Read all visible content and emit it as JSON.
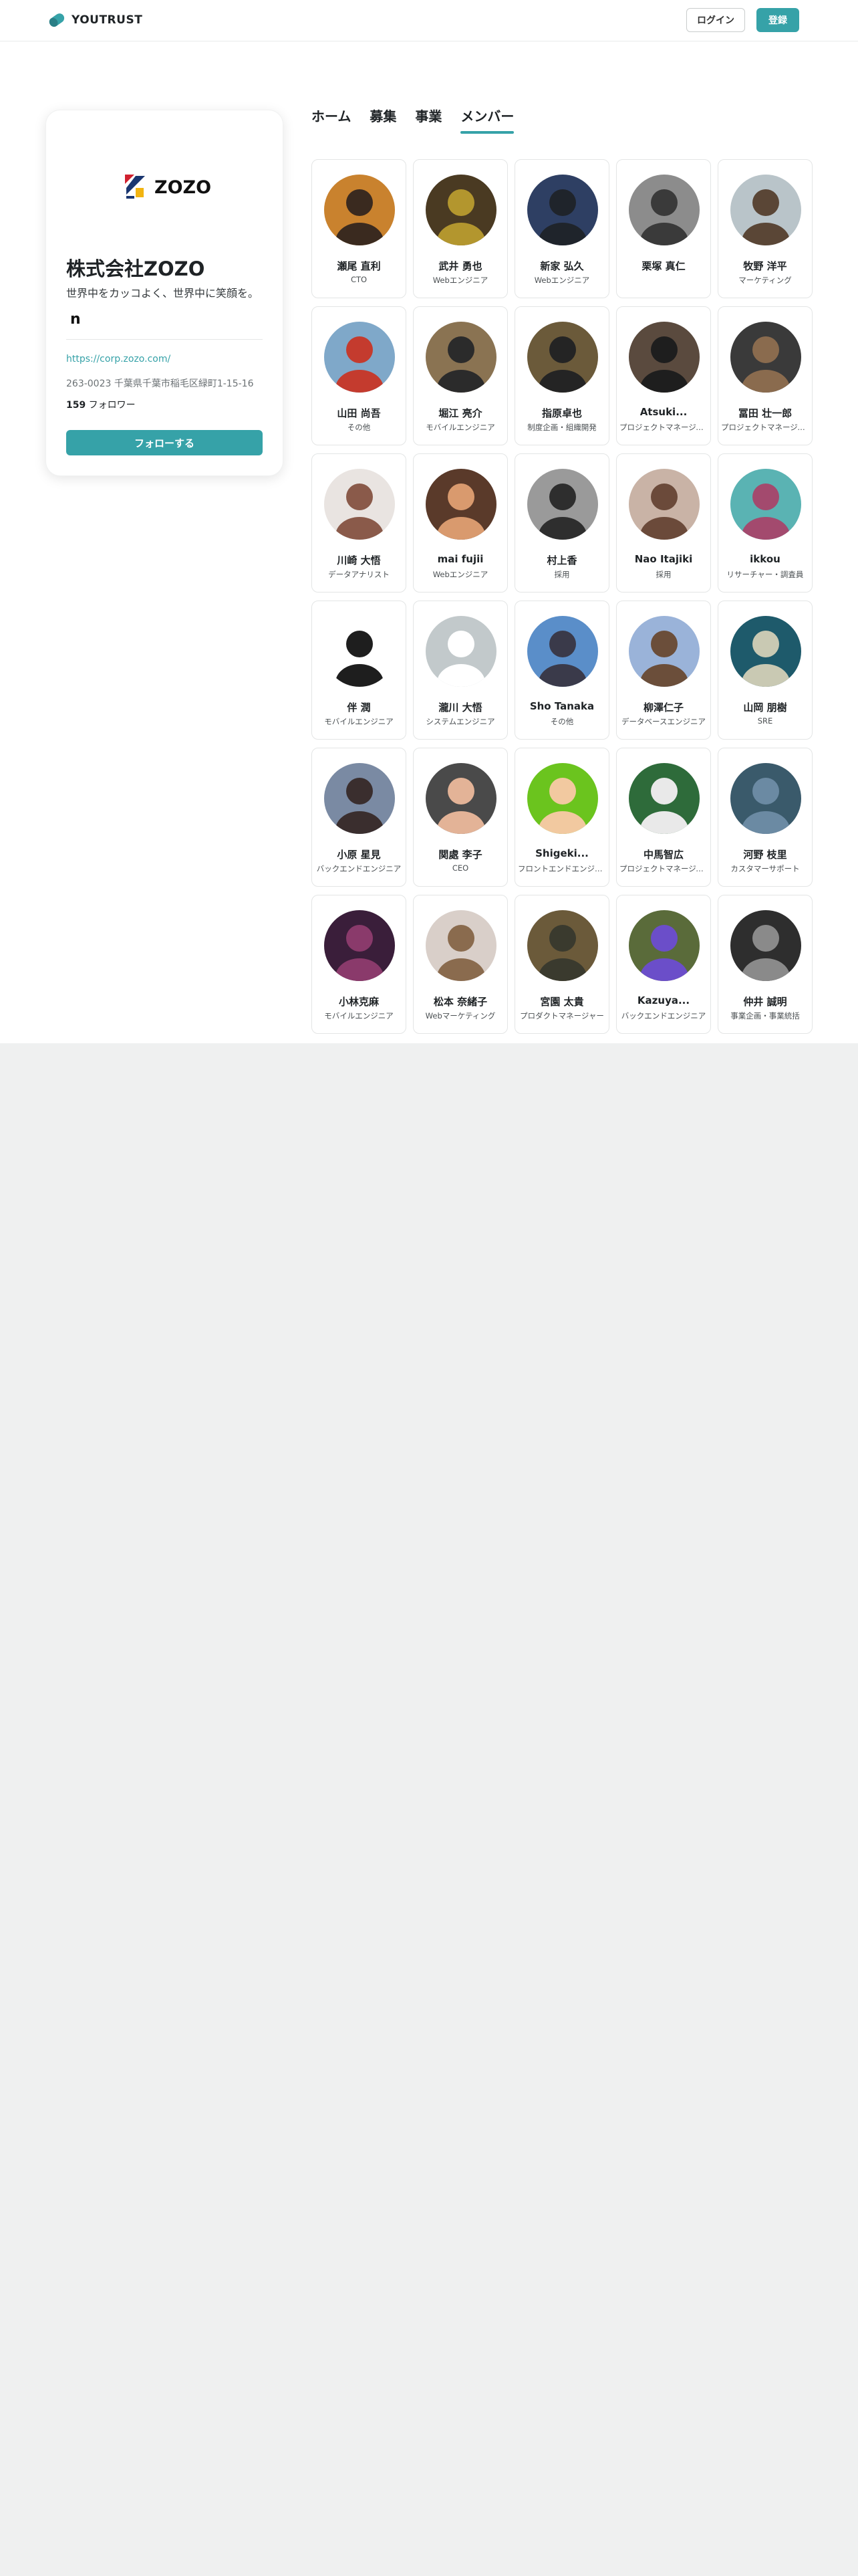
{
  "header": {
    "logo_text": "YOUTRUST",
    "logo_icon": "youtrust-logo-icon",
    "login_label": "ログイン",
    "register_label": "登録"
  },
  "company": {
    "logo_text": "ZOZO",
    "name": "株式会社ZOZO",
    "tagline": "世界中をカッコよく、世界中に笑顔を。",
    "note_icon_glyph": "n",
    "url": "https://corp.zozo.com/",
    "address": "263-0023 千葉県千葉市稲毛区緑町1-15-16",
    "follower_count": "159",
    "follower_label": " フォロワー",
    "follow_button_label": "フォローする"
  },
  "tabs": [
    {
      "label": "ホーム",
      "active": false
    },
    {
      "label": "募集",
      "active": false
    },
    {
      "label": "事業",
      "active": false
    },
    {
      "label": "メンバー",
      "active": true
    }
  ],
  "members": [
    {
      "name": "瀬尾 直利",
      "role": "CTO",
      "avatar": {
        "bg": "#c9822e",
        "fg": "#3a2a1f"
      }
    },
    {
      "name": "武井 勇也",
      "role": "Webエンジニア",
      "avatar": {
        "bg": "#4a3a22",
        "fg": "#b3962e"
      }
    },
    {
      "name": "新家 弘久",
      "role": "Webエンジニア",
      "avatar": {
        "bg": "#2e3f63",
        "fg": "#1f242b"
      }
    },
    {
      "name": "栗塚 真仁",
      "role": "",
      "avatar": {
        "bg": "#8c8c8c",
        "fg": "#3a3a3a"
      }
    },
    {
      "name": "牧野 洋平",
      "role": "マーケティング",
      "avatar": {
        "bg": "#b9c4c9",
        "fg": "#5a4636"
      }
    },
    {
      "name": "山田 尚吾",
      "role": "その他",
      "avatar": {
        "bg": "#7fa8c9",
        "fg": "#c43b2e"
      }
    },
    {
      "name": "堀江 亮介",
      "role": "モバイルエンジニア",
      "avatar": {
        "bg": "#8a7352",
        "fg": "#2b2b2b"
      }
    },
    {
      "name": "指原卓也",
      "role": "制度企画・組織開発",
      "avatar": {
        "bg": "#6b5a3a",
        "fg": "#242424"
      }
    },
    {
      "name": "Atsuki...",
      "role": "プロジェクトマネージャー",
      "avatar": {
        "bg": "#5a4a3e",
        "fg": "#1e1e1e"
      }
    },
    {
      "name": "冨田 壮一郎",
      "role": "プロジェクトマネージャー",
      "avatar": {
        "bg": "#3a3a3a",
        "fg": "#8a6b4e"
      }
    },
    {
      "name": "川崎 大悟",
      "role": "データアナリスト",
      "avatar": {
        "bg": "#e9e4e1",
        "fg": "#8a5a4a"
      }
    },
    {
      "name": "mai fujii",
      "role": "Webエンジニア",
      "avatar": {
        "bg": "#5a3a2a",
        "fg": "#d99a6e"
      }
    },
    {
      "name": "村上香",
      "role": "採用",
      "avatar": {
        "bg": "#9a9a9a",
        "fg": "#2e2e2e"
      }
    },
    {
      "name": "Nao Itajiki",
      "role": "採用",
      "avatar": {
        "bg": "#c9b3a6",
        "fg": "#6b4a3a"
      }
    },
    {
      "name": "ikkou",
      "role": "リサーチャー・調査員",
      "avatar": {
        "bg": "#5ab3b3",
        "fg": "#a34a6e"
      }
    },
    {
      "name": "伴 潤",
      "role": "モバイルエンジニア",
      "avatar": {
        "bg": "#ffffff",
        "fg": "#1e1e1e"
      }
    },
    {
      "name": "瀧川 大悟",
      "role": "システムエンジニア",
      "avatar": {
        "bg": "#c2c9cb",
        "fg": "#ffffff"
      }
    },
    {
      "name": "Sho Tanaka",
      "role": "その他",
      "avatar": {
        "bg": "#5a8ec9",
        "fg": "#3a3a4a"
      }
    },
    {
      "name": "柳澤仁子",
      "role": "データベースエンジニア",
      "avatar": {
        "bg": "#9ab3d9",
        "fg": "#6b4e3a"
      }
    },
    {
      "name": "山岡 朋樹",
      "role": "SRE",
      "avatar": {
        "bg": "#1e5a6b",
        "fg": "#c9c9b3"
      }
    },
    {
      "name": "小原 星見",
      "role": "バックエンドエンジニア",
      "avatar": {
        "bg": "#7a8aa3",
        "fg": "#3a2e2e"
      }
    },
    {
      "name": "関處 李子",
      "role": "CEO",
      "avatar": {
        "bg": "#4a4a4a",
        "fg": "#e3b397"
      }
    },
    {
      "name": "Shigeki...",
      "role": "フロントエンドエンジニア",
      "avatar": {
        "bg": "#6bc41e",
        "fg": "#f2c9a0"
      }
    },
    {
      "name": "中馬智広",
      "role": "プロジェクトマネージャー",
      "avatar": {
        "bg": "#2e6b3a",
        "fg": "#e9e9e9"
      }
    },
    {
      "name": "河野 枝里",
      "role": "カスタマーサポート",
      "avatar": {
        "bg": "#3a5a6b",
        "fg": "#6b8aa3"
      }
    },
    {
      "name": "小林克麻",
      "role": "モバイルエンジニア",
      "avatar": {
        "bg": "#3a1e3a",
        "fg": "#8a3a6b"
      }
    },
    {
      "name": "松本 奈緒子",
      "role": "Webマーケティング",
      "avatar": {
        "bg": "#d9cfc9",
        "fg": "#8a6b4e"
      }
    },
    {
      "name": "宮園 太貴",
      "role": "プロダクトマネージャー",
      "avatar": {
        "bg": "#6b5a3a",
        "fg": "#3a3a2e"
      }
    },
    {
      "name": "Kazuya...",
      "role": "バックエンドエンジニア",
      "avatar": {
        "bg": "#5a6b3a",
        "fg": "#6b4ec9"
      }
    },
    {
      "name": "仲井 誠明",
      "role": "事業企画・事業統括",
      "avatar": {
        "bg": "#2e2e2e",
        "fg": "#8a8a8a"
      }
    }
  ]
}
